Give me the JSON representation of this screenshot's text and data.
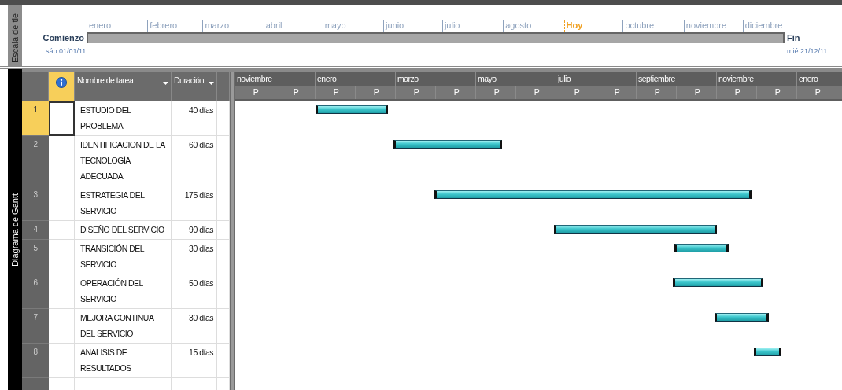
{
  "timescale": {
    "side_label": "Escala de tie",
    "start_label": "Comienzo",
    "start_date": "sáb 01/01/11",
    "end_label": "Fin",
    "end_date": "mié 21/12/11",
    "marks": [
      {
        "kind": "month",
        "label": "enero"
      },
      {
        "kind": "month",
        "label": "febrero"
      },
      {
        "kind": "month",
        "label": "marzo"
      },
      {
        "kind": "month",
        "label": "abril"
      },
      {
        "kind": "month",
        "label": "mayo"
      },
      {
        "kind": "month",
        "label": "junio"
      },
      {
        "kind": "month",
        "label": "julio"
      },
      {
        "kind": "month",
        "label": "agosto"
      },
      {
        "kind": "today",
        "label": "Hoy"
      },
      {
        "kind": "month",
        "label": "octubre"
      },
      {
        "kind": "month",
        "label": "noviembre"
      },
      {
        "kind": "month",
        "label": "diciembre"
      }
    ]
  },
  "gantt": {
    "side_label": "Diagrama de Gantt",
    "columns": [
      "Nombre de tarea",
      "Duración"
    ],
    "timeline_top": [
      "noviembre",
      "enero",
      "marzo",
      "mayo",
      "julio",
      "septiembre",
      "noviembre",
      "enero"
    ],
    "timeline_bottom": [
      "P",
      "P",
      "P",
      "P",
      "P",
      "P",
      "P",
      "P",
      "P",
      "P",
      "P",
      "P",
      "P",
      "P",
      "P"
    ],
    "rows": [
      {
        "number": "1",
        "name": "ESTUDIO DEL PROBLEMA",
        "duration": "40 días",
        "selected": true
      },
      {
        "number": "2",
        "name": "IDENTIFICACION DE LA TECNOLOGÍA ADECUADA",
        "duration": "60 días",
        "selected": false
      },
      {
        "number": "3",
        "name": "ESTRATEGIA DEL SERVICIO",
        "duration": "175 días",
        "selected": false
      },
      {
        "number": "4",
        "name": "DISEÑO DEL SERVICIO",
        "duration": "90 días",
        "selected": false
      },
      {
        "number": "5",
        "name": "TRANSICIÓN DEL SERVICIO",
        "duration": "30 días",
        "selected": false
      },
      {
        "number": "6",
        "name": "OPERACIÓN DEL SERVICIO",
        "duration": "50 días",
        "selected": false
      },
      {
        "number": "7",
        "name": "MEJORA CONTINUA DEL SERVICIO",
        "duration": "30 días",
        "selected": false
      },
      {
        "number": "8",
        "name": "ANALISIS DE RESULTADOS",
        "duration": "15 días",
        "selected": false
      }
    ]
  }
}
